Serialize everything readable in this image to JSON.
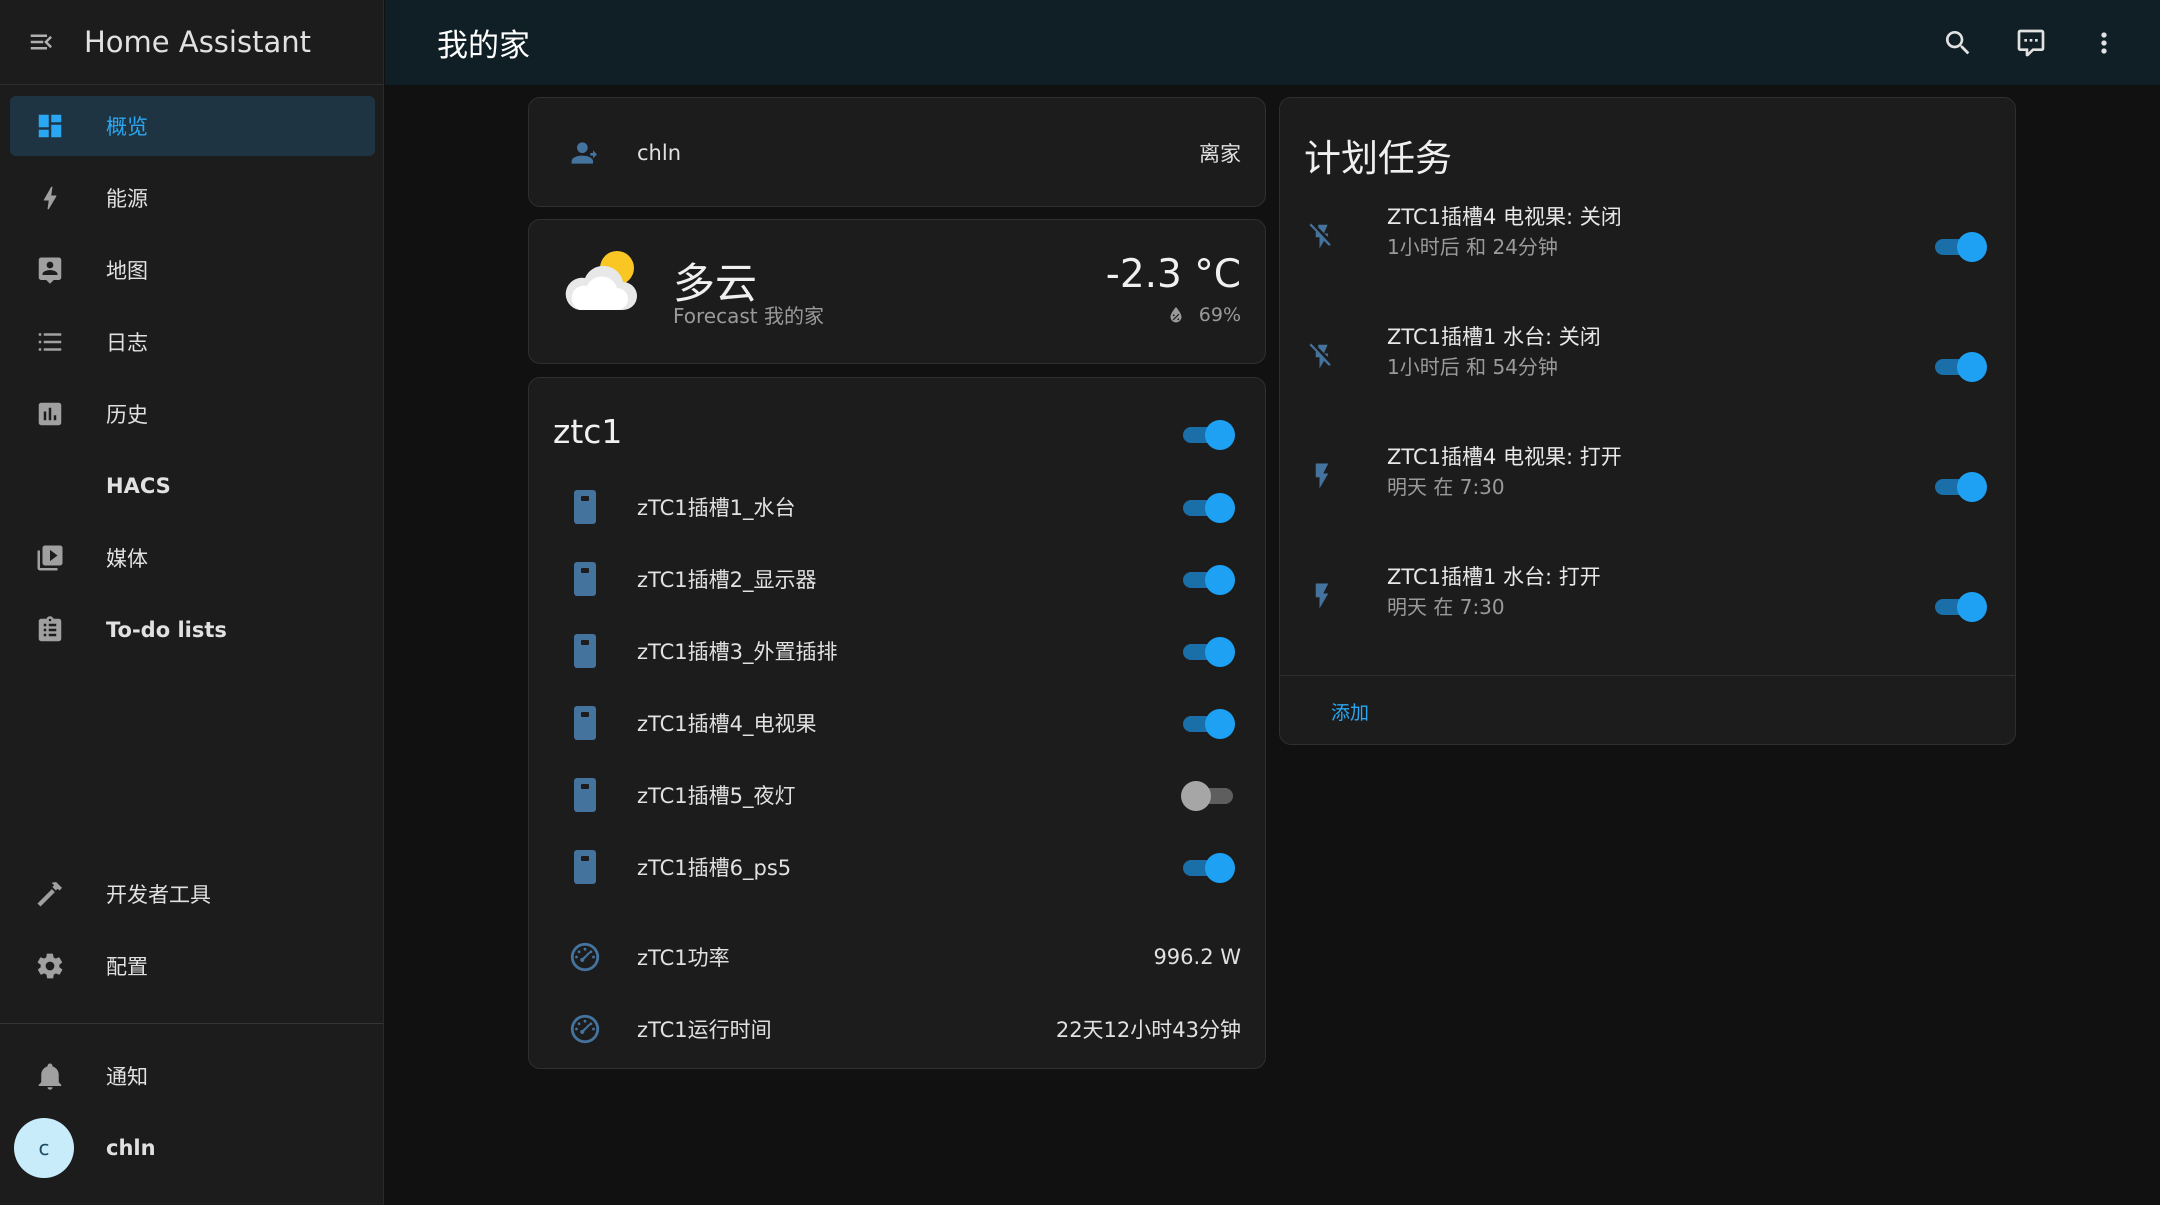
{
  "sidebar": {
    "title": "Home Assistant",
    "items": [
      {
        "label": "概览"
      },
      {
        "label": "能源"
      },
      {
        "label": "地图"
      },
      {
        "label": "日志"
      },
      {
        "label": "历史"
      },
      {
        "label": "HACS"
      },
      {
        "label": "媒体"
      },
      {
        "label": "To-do lists"
      }
    ],
    "bottom_items": [
      {
        "label": "开发者工具"
      },
      {
        "label": "配置"
      }
    ],
    "notifications_label": "通知",
    "user": {
      "initial": "c",
      "name": "chln"
    }
  },
  "header": {
    "title": "我的家"
  },
  "person_card": {
    "name": "chln",
    "state": "离家"
  },
  "weather_card": {
    "condition": "多云",
    "subtitle": "Forecast 我的家",
    "temperature": "-2.3 °C",
    "humidity": "69%"
  },
  "ztc1_card": {
    "title": "ztc1",
    "header_toggle_on": true,
    "rows": [
      {
        "name": "zTC1插槽1_水台",
        "on": true
      },
      {
        "name": "zTC1插槽2_显示器",
        "on": true
      },
      {
        "name": "zTC1插槽3_外置插排",
        "on": true
      },
      {
        "name": "zTC1插槽4_电视果",
        "on": true
      },
      {
        "name": "zTC1插槽5_夜灯",
        "on": false
      },
      {
        "name": "zTC1插槽6_ps5",
        "on": true
      }
    ],
    "sensors": [
      {
        "name": "zTC1功率",
        "value": "996.2 W"
      },
      {
        "name": "zTC1运行时间",
        "value": "22天12小时43分钟"
      }
    ]
  },
  "schedule_card": {
    "title": "计划任务",
    "items": [
      {
        "title": "ZTC1插槽4 电视果: 关闭",
        "time": "1小时后 和 24分钟",
        "action": "off",
        "on": true
      },
      {
        "title": "ZTC1插槽1 水台: 关闭",
        "time": "1小时后 和 54分钟",
        "action": "off",
        "on": true
      },
      {
        "title": "ZTC1插槽4 电视果: 打开",
        "time": "明天 在 7:30",
        "action": "on",
        "on": true
      },
      {
        "title": "ZTC1插槽1 水台: 打开",
        "time": "明天 在 7:30",
        "action": "on",
        "on": true
      }
    ],
    "add_label": "添加"
  },
  "colors": {
    "accent": "#1ea1f2",
    "sidebar_bg": "#1c1c1c",
    "header_bg": "#101e25",
    "card_bg": "#1c1c1c",
    "icon_blue": "#44739e"
  }
}
